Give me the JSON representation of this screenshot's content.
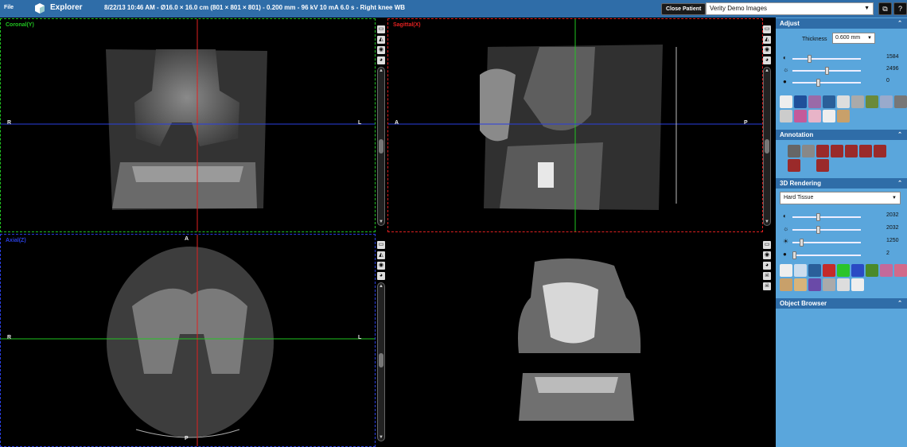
{
  "menu": {
    "file_label": "File"
  },
  "app": {
    "title": "Explorer"
  },
  "study": {
    "info": "8/22/13 10:46 AM - Ø16.0 × 16.0 cm (801 × 801 × 801) - 0.200 mm - 96 kV 10 mA 6.0 s - Right knee WB"
  },
  "header": {
    "close_patient_label": "Close Patient",
    "study_select_value": "Verity Demo Images",
    "layout_icon": "layout-icon",
    "help_icon": "help-icon"
  },
  "viewports": {
    "coronal": {
      "label": "Coronal(Y)",
      "left": "R",
      "right": "L",
      "color": "#21c421"
    },
    "sagittal": {
      "label": "Sagittal(X)",
      "left": "A",
      "right": "P",
      "color": "#e02020"
    },
    "axial": {
      "label": "Axial(Z)",
      "left": "R",
      "right": "L",
      "top": "A",
      "bottom": "P",
      "color": "#2a3fe0"
    },
    "render3d": {
      "label": ""
    }
  },
  "panel": {
    "adjust": {
      "title": "Adjust",
      "thickness_label": "Thickness",
      "thickness_value": "0.600 mm",
      "sliders": [
        {
          "icon": "contrast-icon",
          "glyph": "◐",
          "value": "1584",
          "level": 0.22
        },
        {
          "icon": "brightness-icon",
          "glyph": "☼",
          "value": "2496",
          "level": 0.48
        },
        {
          "icon": "gamma-icon",
          "glyph": "●",
          "value": "0",
          "level": 0.35
        }
      ]
    },
    "annotation": {
      "title": "Annotation"
    },
    "rendering": {
      "title": "3D Rendering",
      "preset_value": "Hard Tissue",
      "sliders": [
        {
          "icon": "contrast-icon",
          "glyph": "◐",
          "value": "2032",
          "level": 0.35
        },
        {
          "icon": "brightness-icon",
          "glyph": "☼",
          "value": "2032",
          "level": 0.35
        },
        {
          "icon": "opacity-icon",
          "glyph": "☀",
          "value": "1250",
          "level": 0.1
        },
        {
          "icon": "gamma-icon",
          "glyph": "●",
          "value": "2",
          "level": 0.0
        }
      ]
    },
    "object_browser": {
      "title": "Object Browser"
    }
  },
  "colors": {
    "header_blue": "#2f6da8",
    "panel_blue": "#5aa6dc"
  }
}
